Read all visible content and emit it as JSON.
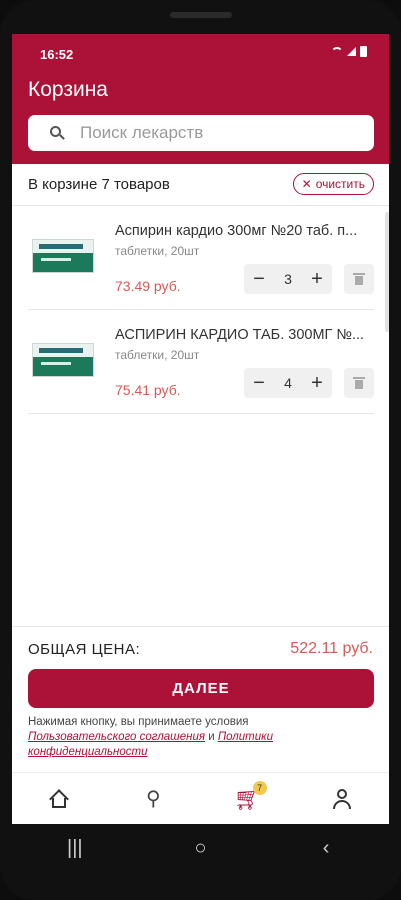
{
  "status_bar": {
    "time": "16:52"
  },
  "header": {
    "title": "Корзина"
  },
  "search": {
    "placeholder": "Поиск лекарств"
  },
  "cart": {
    "count_text": "В корзине 7 товаров",
    "clear_label": "очистить",
    "items": [
      {
        "name": "Аспирин кардио 300мг №20 таб. п...",
        "subtitle": "таблетки, 20шт",
        "price": "73.49 руб.",
        "quantity": "3"
      },
      {
        "name": "АСПИРИН КАРДИО ТАБ. 300МГ №...",
        "subtitle": "таблетки, 20шт",
        "price": "75.41 руб.",
        "quantity": "4"
      }
    ]
  },
  "footer": {
    "total_label": "ОБЩАЯ ЦЕНА:",
    "total_value": "522.11 руб.",
    "next_label": "ДАЛЕЕ",
    "terms_text": "Нажимая кнопку, вы принимаете условия",
    "terms_link_1": "Пользовательского соглашения",
    "terms_and": "и",
    "terms_link_2": "Политики конфиденциальности"
  },
  "nav": {
    "cart_badge": "7"
  },
  "colors": {
    "accent": "#ac1238",
    "price": "#d85a57",
    "badge": "#f2c94c"
  }
}
